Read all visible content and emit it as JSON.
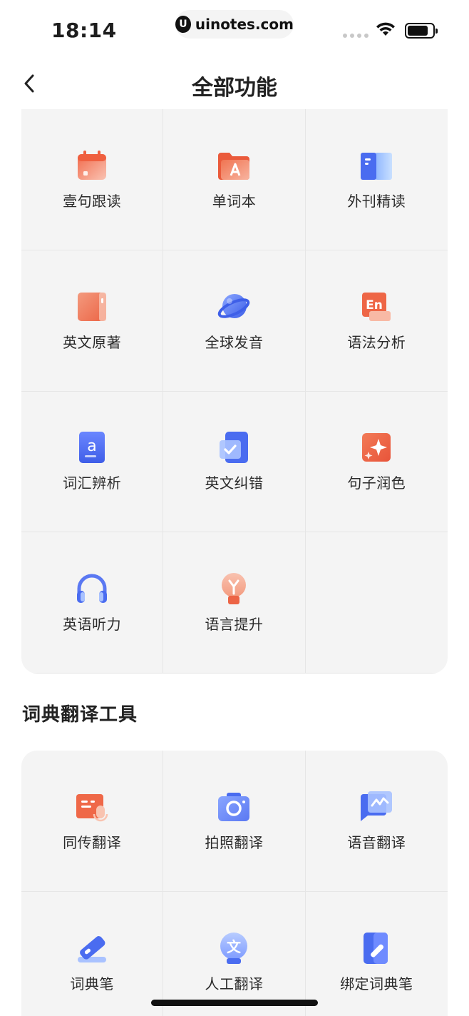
{
  "status_bar": {
    "time": "18:14",
    "url_logo": "U",
    "url": "uinotes.com"
  },
  "nav": {
    "back_icon": "chevron-left-icon",
    "title": "全部功能"
  },
  "features": {
    "items": [
      {
        "label": "壹句跟读",
        "icon": "calendar-icon"
      },
      {
        "label": "单词本",
        "icon": "folder-a-icon"
      },
      {
        "label": "外刊精读",
        "icon": "open-book-icon"
      },
      {
        "label": "英文原著",
        "icon": "book-icon"
      },
      {
        "label": "全球发音",
        "icon": "planet-icon"
      },
      {
        "label": "语法分析",
        "icon": "en-badge-icon"
      },
      {
        "label": "词汇辨析",
        "icon": "letter-a-icon"
      },
      {
        "label": "英文纠错",
        "icon": "check-doc-icon"
      },
      {
        "label": "句子润色",
        "icon": "sparkle-icon"
      },
      {
        "label": "英语听力",
        "icon": "headphones-icon"
      },
      {
        "label": "语言提升",
        "icon": "lightbulb-icon"
      }
    ]
  },
  "dict_section": {
    "title": "词典翻译工具",
    "items": [
      {
        "label": "同传翻译",
        "icon": "speech-doc-icon"
      },
      {
        "label": "拍照翻译",
        "icon": "camera-icon"
      },
      {
        "label": "语音翻译",
        "icon": "chat-wave-icon"
      },
      {
        "label": "词典笔",
        "icon": "pen-icon"
      },
      {
        "label": "人工翻译",
        "icon": "translate-head-icon"
      },
      {
        "label": "绑定词典笔",
        "icon": "bind-pen-icon"
      }
    ]
  },
  "colors": {
    "orange": "#f07451",
    "blue": "#4a6cf0",
    "card_bg": "#f4f4f4"
  }
}
